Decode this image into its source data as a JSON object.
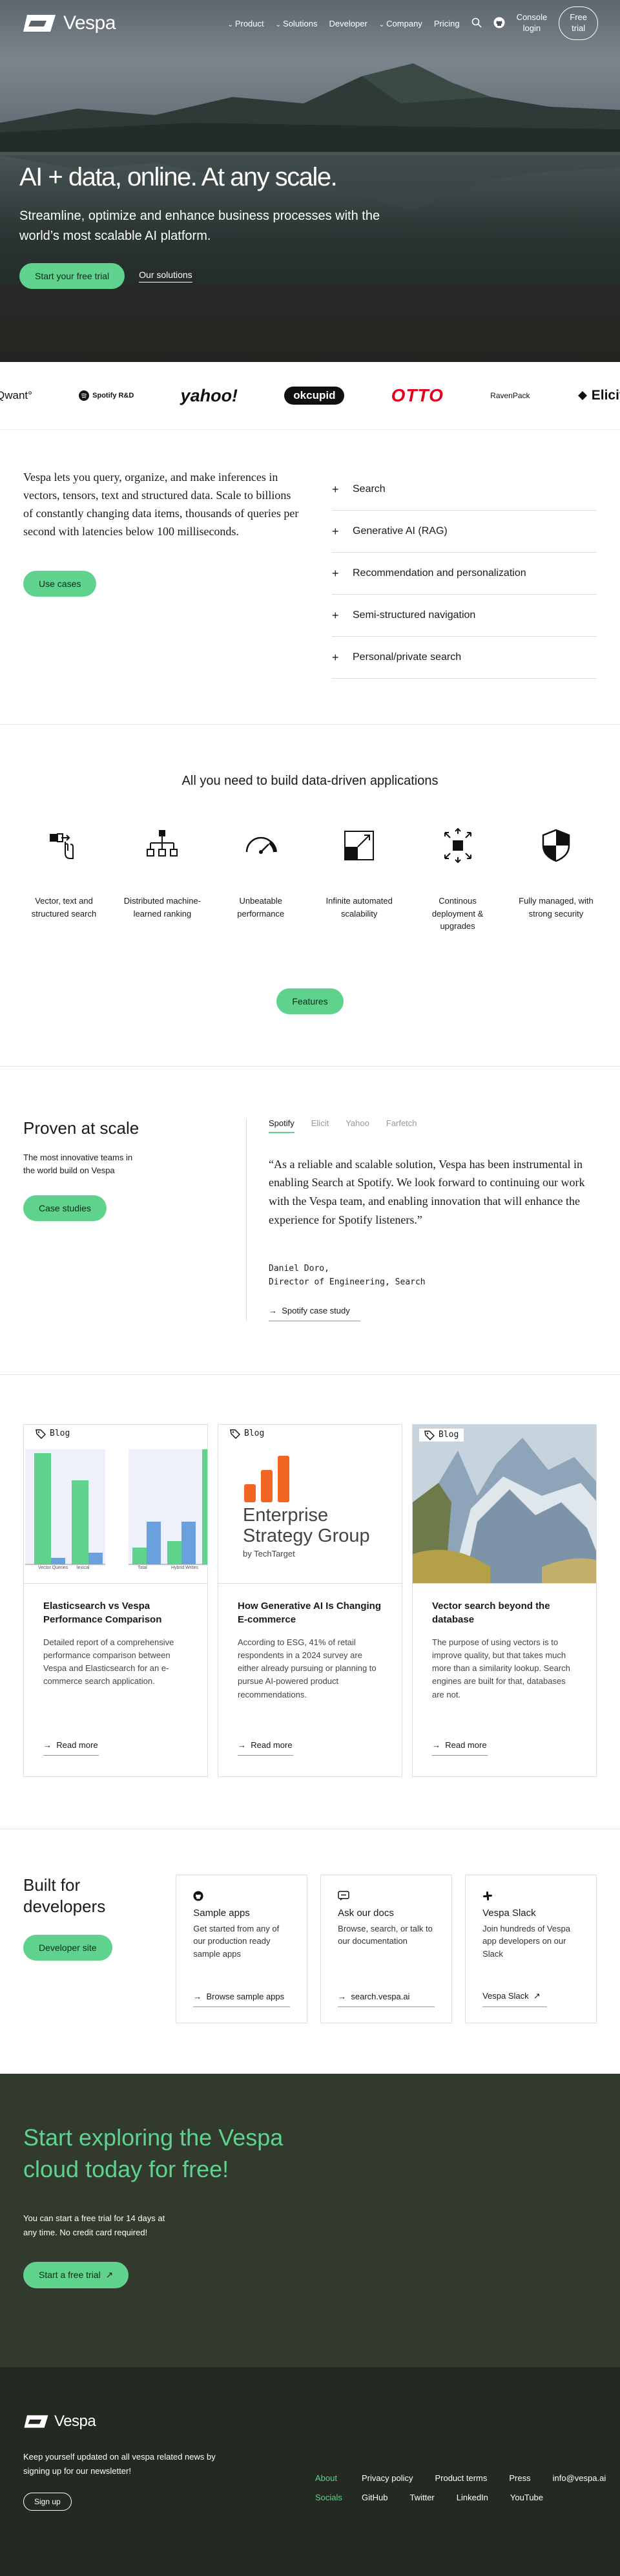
{
  "nav": {
    "brand": "Vespa",
    "items": [
      "Product",
      "Solutions",
      "Developer",
      "Company"
    ],
    "pricing": "Pricing",
    "console_line1": "Console",
    "console_line2": "login",
    "trial_line1": "Free",
    "trial_line2": "trial"
  },
  "hero": {
    "title": "AI + data, online. At any scale.",
    "subtitle": "Streamline, optimize and enhance business processes with the world’s most scalable AI platform.",
    "primary_cta": "Start your free trial",
    "secondary_cta": "Our solutions"
  },
  "logo_strip": [
    "Qwant°",
    "Spotify R&D",
    "yahoo!",
    "okcupid",
    "OTTO",
    "RavenPack",
    "Elicit"
  ],
  "intro": {
    "text": "Vespa lets you query, organize, and make inferences in vectors, tensors, text and structured data. Scale to billions of constantly changing data items, thousands of queries per second with latencies below 100 milliseconds.",
    "button": "Use cases",
    "items": [
      "Search",
      "Generative AI (RAG)",
      "Recommendation and personalization",
      "Semi-structured navigation",
      "Personal/private search"
    ]
  },
  "features": {
    "title": "All you need to build data-driven applications",
    "items": [
      {
        "label": "Vector, text and structured search",
        "icon": "vector-search-icon"
      },
      {
        "label": "Distributed machine-learned ranking",
        "icon": "hierarchy-icon"
      },
      {
        "label": "Unbeatable performance",
        "icon": "gauge-icon"
      },
      {
        "label": "Infinite automated scalability",
        "icon": "scale-icon"
      },
      {
        "label": "Continous deployment & upgrades",
        "icon": "deploy-arrows-icon"
      },
      {
        "label": "Fully managed, with strong security",
        "icon": "shield-icon"
      }
    ],
    "button": "Features"
  },
  "proven": {
    "title": "Proven at scale",
    "subtitle": "The most innovative teams in the world build on Vespa",
    "button": "Case studies",
    "tabs": [
      "Spotify",
      "Elicit",
      "Yahoo",
      "Farfetch"
    ],
    "quote": "“As a reliable and scalable solution, Vespa has been instrumental in enabling Search at Spotify. We look forward to continuing our work with the Vespa team, and enabling innovation that will enhance the experience for Spotify listeners.”",
    "author_name": "Daniel Doro,",
    "author_title": "Director of Engineering, Search",
    "link": "Spotify case study"
  },
  "blog": {
    "tag": "Blog",
    "read_more": "Read more",
    "cards": [
      {
        "title": "Elasticsearch vs Vespa Performance Comparison",
        "text": "Detailed report of a comprehensive performance comparison between Vespa and Elasticsearch for an e-commerce search application."
      },
      {
        "title": "How Generative AI Is Changing E-commerce",
        "text": "According to ESG, 41% of retail respondents in a 2024 survey are either already pursuing or planning to pursue AI-powered product recommendations."
      },
      {
        "title": "Vector search beyond the database",
        "text": "The purpose of using vectors is to improve quality, but that takes much more than a similarity lookup. Search engines are built for that, databases are not."
      }
    ],
    "chart_labels": [
      "Vector Queries",
      "lexical",
      "Total",
      "Hybrid Writes"
    ],
    "esg_line1": "Enterprise",
    "esg_line2": "Strategy Group",
    "esg_line3": "by TechTarget"
  },
  "developers": {
    "title": "Built for developers",
    "button": "Developer site",
    "cards": [
      {
        "title": "Sample apps",
        "text": "Get started from any of our production ready sample apps",
        "link": "Browse sample apps",
        "icon": "github-icon"
      },
      {
        "title": "Ask our docs",
        "text": "Browse, search, or talk to our documentation",
        "link": "search.vespa.ai",
        "icon": "chat-icon"
      },
      {
        "title": "Vespa Slack",
        "text": "Join hundreds of Vespa app developers on our Slack",
        "link": "Vespa Slack",
        "icon": "slack-icon"
      }
    ]
  },
  "cta": {
    "title": "Start exploring the Vespa cloud today for free!",
    "text": "You can start a free trial for 14 days at any time. No credit card required!",
    "button": "Start a free trial"
  },
  "footer": {
    "brand": "Vespa",
    "newsletter": "Keep yourself updated on all vespa related news by signing up for our newsletter!",
    "signup": "Sign up",
    "about": "About",
    "socials": "Socials",
    "about_links": [
      "Privacy policy",
      "Product terms",
      "Press",
      "info@vespa.ai"
    ],
    "social_links": [
      "GitHub",
      "Twitter",
      "LinkedIn",
      "YouTube"
    ]
  },
  "colors": {
    "accent": "#5fd28e",
    "cta_bg": "#313a2d",
    "footer_bg": "#232a22"
  }
}
